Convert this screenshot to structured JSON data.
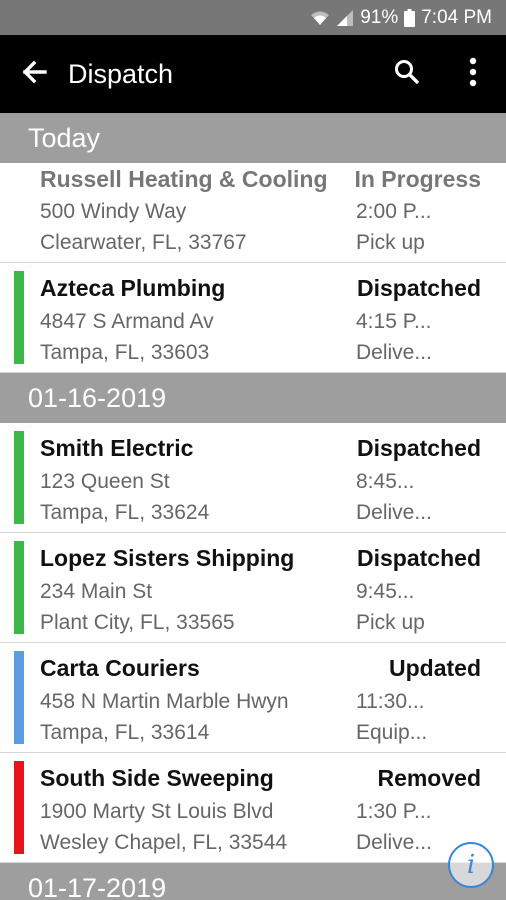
{
  "status_bar": {
    "battery": "91%",
    "time": "7:04 PM",
    "icons": [
      "wifi-icon",
      "signal-icon",
      "battery-icon"
    ]
  },
  "app_bar": {
    "title": "Dispatch",
    "icons": [
      "back-arrow-icon",
      "search-icon",
      "more-vert-icon"
    ]
  },
  "colors": {
    "dispatched": "#3cb84a",
    "updated": "#5b9be0",
    "removed": "#e8141c",
    "header_bg": "#9e9e9e",
    "app_bar_bg": "#000000"
  },
  "sections": [
    {
      "header": "Today",
      "items": [
        {
          "name": "Russell Heating & Cooling",
          "address": "500 Windy Way",
          "city": "Clearwater, FL, 33767",
          "status": "In Progress",
          "time": "2:00 P...",
          "type": "Pick up",
          "stripe": "none"
        },
        {
          "name": "Azteca Plumbing",
          "address": "4847 S Armand Av",
          "city": "Tampa, FL, 33603",
          "status": "Dispatched",
          "time": "4:15 P...",
          "type": "Delive...",
          "stripe": "dispatched"
        }
      ]
    },
    {
      "header": "01-16-2019",
      "items": [
        {
          "name": "Smith Electric",
          "address": "123 Queen St",
          "city": "Tampa, FL, 33624",
          "status": "Dispatched",
          "time": "8:45...",
          "type": "Delive...",
          "stripe": "dispatched"
        },
        {
          "name": "Lopez Sisters Shipping",
          "address": "234 Main St",
          "city": "Plant City, FL, 33565",
          "status": "Dispatched",
          "time": "9:45...",
          "type": "Pick up",
          "stripe": "dispatched"
        },
        {
          "name": "Carta Couriers",
          "address": "458 N Martin Marble Hwyn",
          "city": "Tampa, FL, 33614",
          "status": "Updated",
          "time": "11:30...",
          "type": "Equip...",
          "stripe": "updated"
        },
        {
          "name": "South Side Sweeping",
          "address": "1900 Marty St Louis Blvd",
          "city": "Wesley Chapel, FL, 33544",
          "status": "Removed",
          "time": "1:30 P...",
          "type": "Delive...",
          "stripe": "removed"
        }
      ]
    },
    {
      "header": "01-17-2019",
      "items": []
    }
  ],
  "fab": {
    "label": "i",
    "icon": "info-icon"
  }
}
